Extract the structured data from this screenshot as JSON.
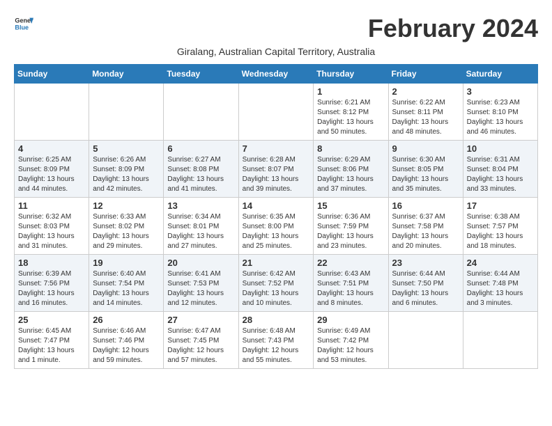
{
  "app": {
    "name_general": "General",
    "name_blue": "Blue"
  },
  "title": {
    "month_year": "February 2024",
    "location": "Giralang, Australian Capital Territory, Australia"
  },
  "days_of_week": [
    "Sunday",
    "Monday",
    "Tuesday",
    "Wednesday",
    "Thursday",
    "Friday",
    "Saturday"
  ],
  "weeks": [
    [
      {
        "day": "",
        "info": ""
      },
      {
        "day": "",
        "info": ""
      },
      {
        "day": "",
        "info": ""
      },
      {
        "day": "",
        "info": ""
      },
      {
        "day": "1",
        "info": "Sunrise: 6:21 AM\nSunset: 8:12 PM\nDaylight: 13 hours\nand 50 minutes."
      },
      {
        "day": "2",
        "info": "Sunrise: 6:22 AM\nSunset: 8:11 PM\nDaylight: 13 hours\nand 48 minutes."
      },
      {
        "day": "3",
        "info": "Sunrise: 6:23 AM\nSunset: 8:10 PM\nDaylight: 13 hours\nand 46 minutes."
      }
    ],
    [
      {
        "day": "4",
        "info": "Sunrise: 6:25 AM\nSunset: 8:09 PM\nDaylight: 13 hours\nand 44 minutes."
      },
      {
        "day": "5",
        "info": "Sunrise: 6:26 AM\nSunset: 8:09 PM\nDaylight: 13 hours\nand 42 minutes."
      },
      {
        "day": "6",
        "info": "Sunrise: 6:27 AM\nSunset: 8:08 PM\nDaylight: 13 hours\nand 41 minutes."
      },
      {
        "day": "7",
        "info": "Sunrise: 6:28 AM\nSunset: 8:07 PM\nDaylight: 13 hours\nand 39 minutes."
      },
      {
        "day": "8",
        "info": "Sunrise: 6:29 AM\nSunset: 8:06 PM\nDaylight: 13 hours\nand 37 minutes."
      },
      {
        "day": "9",
        "info": "Sunrise: 6:30 AM\nSunset: 8:05 PM\nDaylight: 13 hours\nand 35 minutes."
      },
      {
        "day": "10",
        "info": "Sunrise: 6:31 AM\nSunset: 8:04 PM\nDaylight: 13 hours\nand 33 minutes."
      }
    ],
    [
      {
        "day": "11",
        "info": "Sunrise: 6:32 AM\nSunset: 8:03 PM\nDaylight: 13 hours\nand 31 minutes."
      },
      {
        "day": "12",
        "info": "Sunrise: 6:33 AM\nSunset: 8:02 PM\nDaylight: 13 hours\nand 29 minutes."
      },
      {
        "day": "13",
        "info": "Sunrise: 6:34 AM\nSunset: 8:01 PM\nDaylight: 13 hours\nand 27 minutes."
      },
      {
        "day": "14",
        "info": "Sunrise: 6:35 AM\nSunset: 8:00 PM\nDaylight: 13 hours\nand 25 minutes."
      },
      {
        "day": "15",
        "info": "Sunrise: 6:36 AM\nSunset: 7:59 PM\nDaylight: 13 hours\nand 23 minutes."
      },
      {
        "day": "16",
        "info": "Sunrise: 6:37 AM\nSunset: 7:58 PM\nDaylight: 13 hours\nand 20 minutes."
      },
      {
        "day": "17",
        "info": "Sunrise: 6:38 AM\nSunset: 7:57 PM\nDaylight: 13 hours\nand 18 minutes."
      }
    ],
    [
      {
        "day": "18",
        "info": "Sunrise: 6:39 AM\nSunset: 7:56 PM\nDaylight: 13 hours\nand 16 minutes."
      },
      {
        "day": "19",
        "info": "Sunrise: 6:40 AM\nSunset: 7:54 PM\nDaylight: 13 hours\nand 14 minutes."
      },
      {
        "day": "20",
        "info": "Sunrise: 6:41 AM\nSunset: 7:53 PM\nDaylight: 13 hours\nand 12 minutes."
      },
      {
        "day": "21",
        "info": "Sunrise: 6:42 AM\nSunset: 7:52 PM\nDaylight: 13 hours\nand 10 minutes."
      },
      {
        "day": "22",
        "info": "Sunrise: 6:43 AM\nSunset: 7:51 PM\nDaylight: 13 hours\nand 8 minutes."
      },
      {
        "day": "23",
        "info": "Sunrise: 6:44 AM\nSunset: 7:50 PM\nDaylight: 13 hours\nand 6 minutes."
      },
      {
        "day": "24",
        "info": "Sunrise: 6:44 AM\nSunset: 7:48 PM\nDaylight: 13 hours\nand 3 minutes."
      }
    ],
    [
      {
        "day": "25",
        "info": "Sunrise: 6:45 AM\nSunset: 7:47 PM\nDaylight: 13 hours\nand 1 minute."
      },
      {
        "day": "26",
        "info": "Sunrise: 6:46 AM\nSunset: 7:46 PM\nDaylight: 12 hours\nand 59 minutes."
      },
      {
        "day": "27",
        "info": "Sunrise: 6:47 AM\nSunset: 7:45 PM\nDaylight: 12 hours\nand 57 minutes."
      },
      {
        "day": "28",
        "info": "Sunrise: 6:48 AM\nSunset: 7:43 PM\nDaylight: 12 hours\nand 55 minutes."
      },
      {
        "day": "29",
        "info": "Sunrise: 6:49 AM\nSunset: 7:42 PM\nDaylight: 12 hours\nand 53 minutes."
      },
      {
        "day": "",
        "info": ""
      },
      {
        "day": "",
        "info": ""
      }
    ]
  ]
}
